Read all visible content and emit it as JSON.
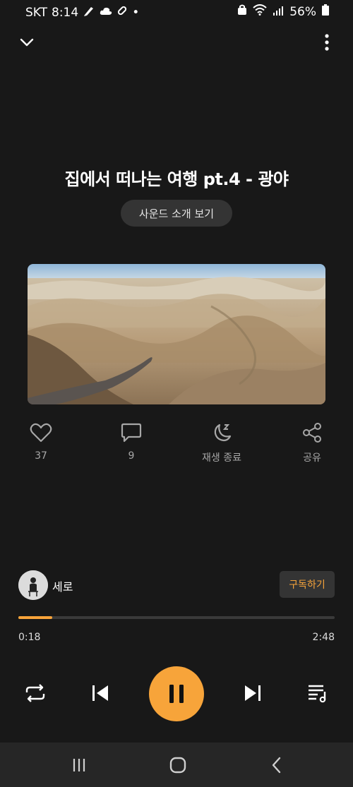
{
  "status_bar": {
    "carrier": "SKT",
    "time": "8:14",
    "dot": "•",
    "battery": "56%"
  },
  "header": {
    "collapse_icon": "chevron-down-icon",
    "menu_icon": "more-vertical-icon"
  },
  "track": {
    "title": "집에서 떠나는 여행 pt.4 - 광야",
    "intro_button": "사운드 소개 보기"
  },
  "actions": {
    "likes": "37",
    "comments": "9",
    "sleep_timer": "재생 종료",
    "share": "공유"
  },
  "artist": {
    "name": "세로",
    "subscribe_label": "구독하기"
  },
  "player": {
    "elapsed": "0:18",
    "duration": "2:48",
    "progress_fraction": 0.107,
    "accent_color": "#f7a43a"
  },
  "colors": {
    "background": "#181818",
    "pill_bg": "#343434",
    "muted_text": "#a7a7a7"
  }
}
